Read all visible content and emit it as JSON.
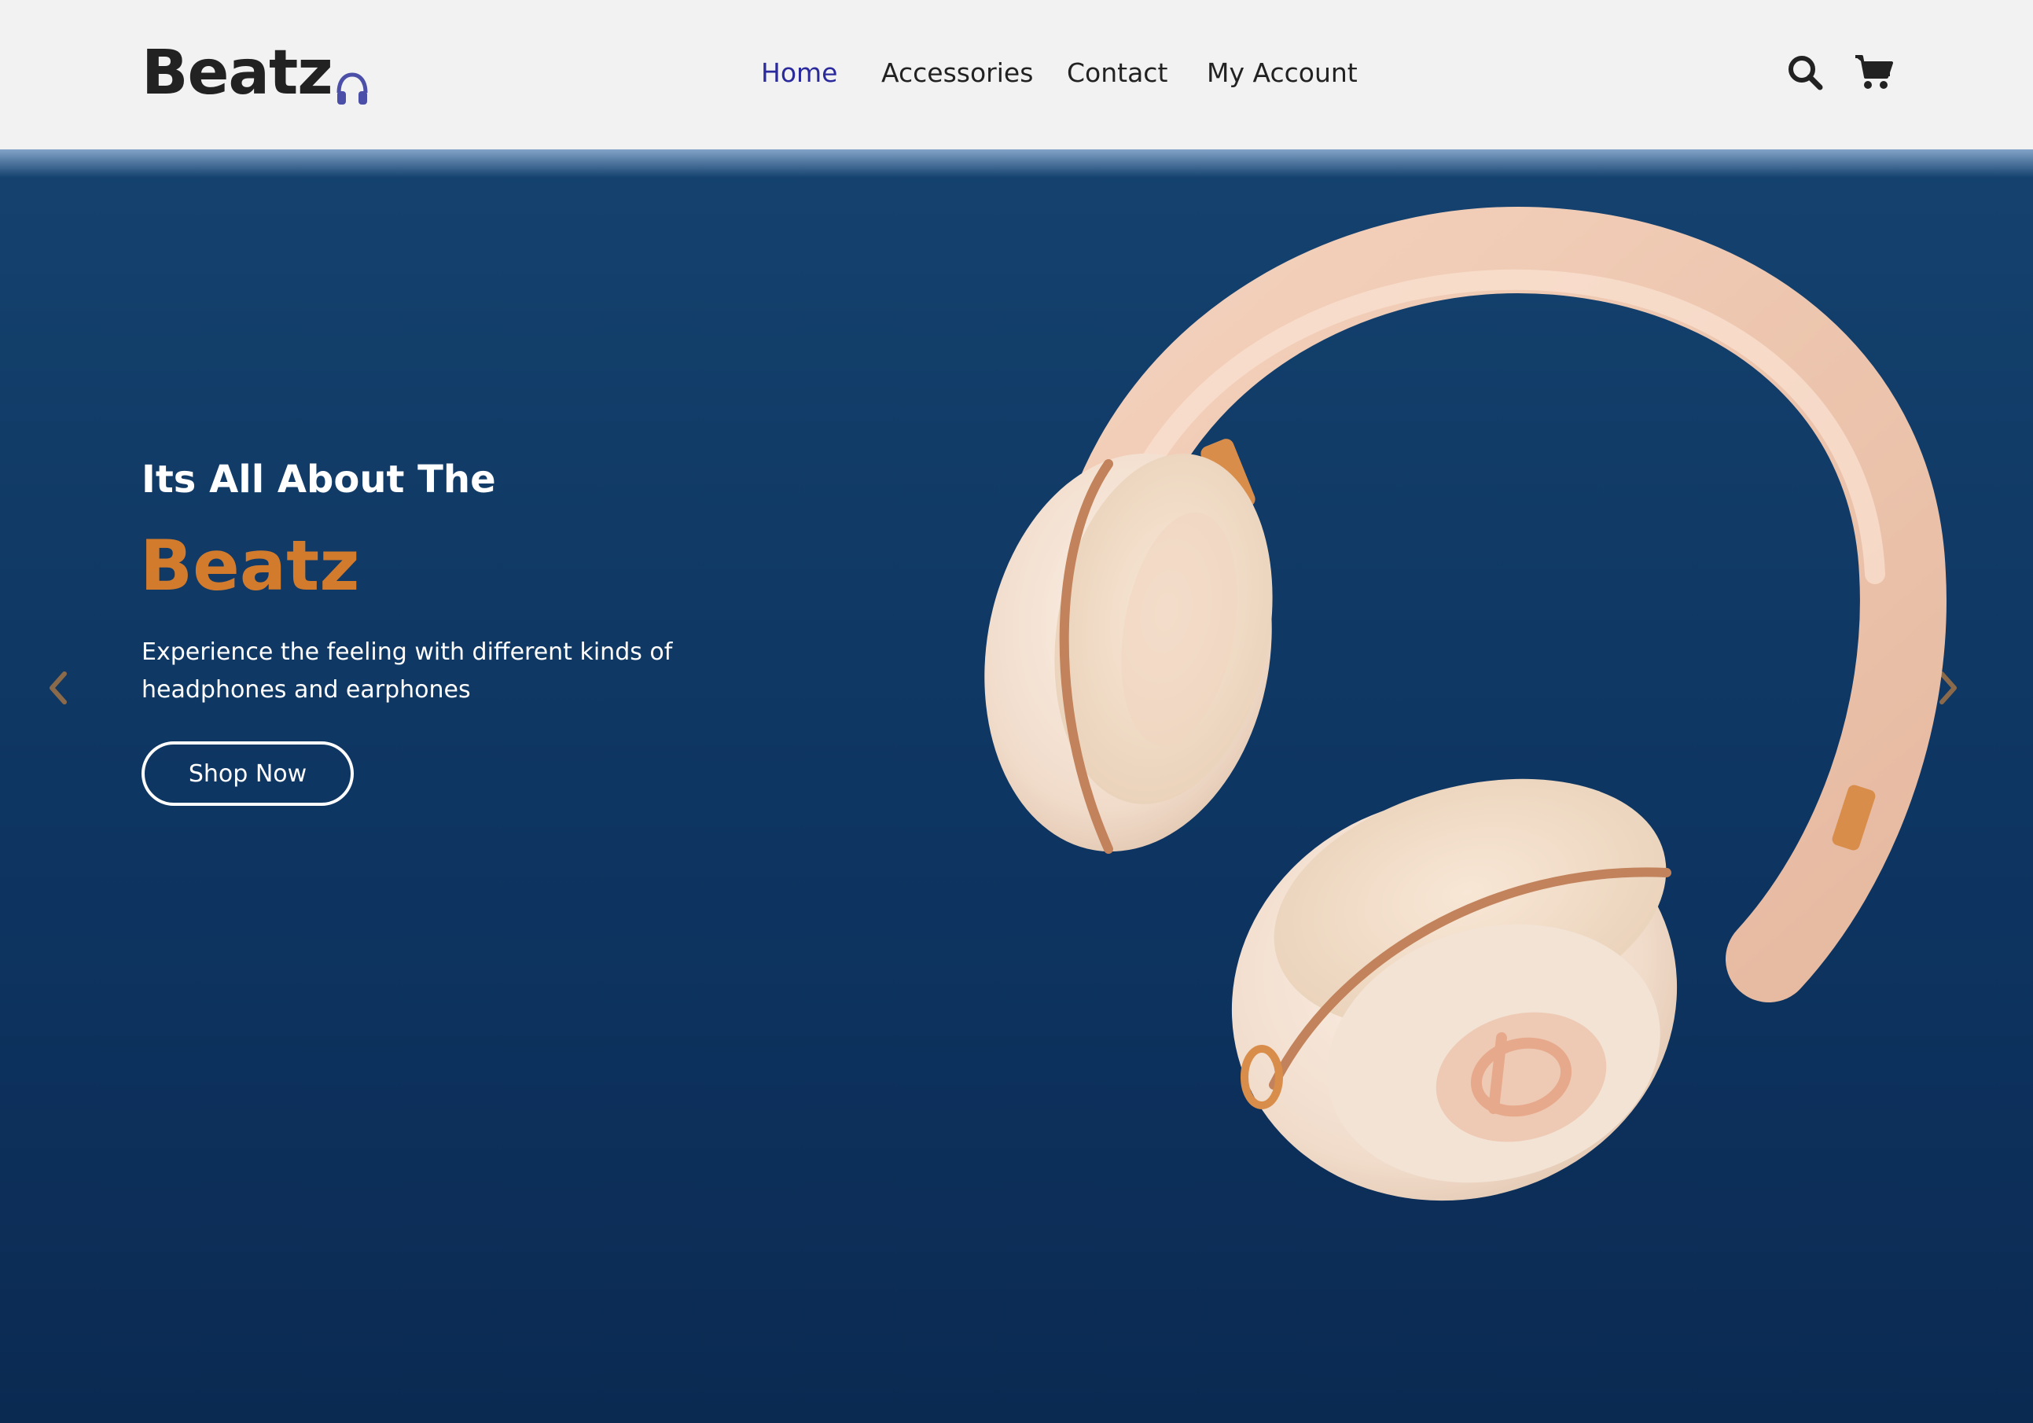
{
  "brand": {
    "name": "Beatz",
    "logo_icon": "headphones-icon",
    "logo_icon_color": "#4b4fa8"
  },
  "nav": {
    "items": [
      {
        "label": "Home",
        "active": true
      },
      {
        "label": "Accessories",
        "active": false
      },
      {
        "label": "Contact",
        "active": false
      },
      {
        "label": "My Account",
        "active": false
      }
    ],
    "active_color": "#2a2a9c",
    "icons": [
      "search-icon",
      "cart-icon"
    ]
  },
  "hero": {
    "eyebrow": "Its All About The",
    "title": "Beatz",
    "description": "Experience the feeling with different kinds of headphones and earphones",
    "cta_label": "Shop Now",
    "accent_color": "#d27b2c",
    "background_color": "#113a66",
    "prev_icon": "chevron-left-icon",
    "next_icon": "chevron-right-icon",
    "product_image": "headphones-product"
  }
}
